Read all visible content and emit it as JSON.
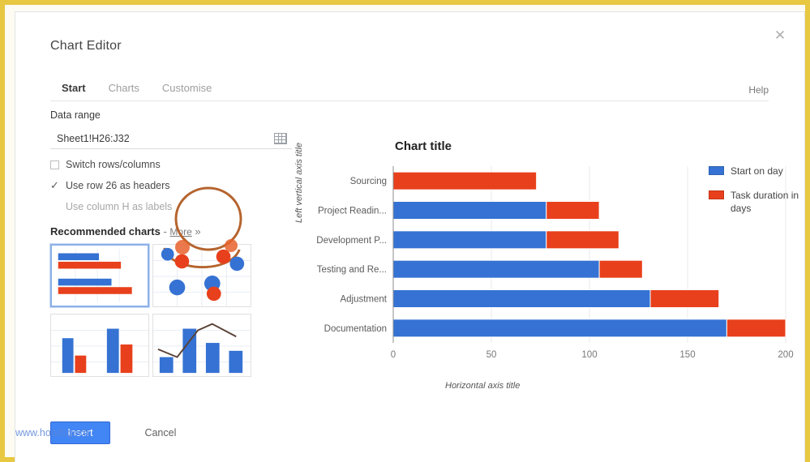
{
  "dialog": {
    "title": "Chart Editor",
    "close_icon": "close-icon",
    "help_label": "Help"
  },
  "tabs": [
    {
      "label": "Start",
      "active": true
    },
    {
      "label": "Charts",
      "active": false
    },
    {
      "label": "Customise",
      "active": false
    }
  ],
  "data_range": {
    "label": "Data range",
    "value": "Sheet1!H26:J32",
    "grid_icon": "select-range-grid-icon"
  },
  "options": [
    {
      "label": "Switch rows/columns",
      "checked": false,
      "enabled": true
    },
    {
      "label": "Use row 26 as headers",
      "checked": true,
      "enabled": true
    },
    {
      "label": "Use column H as labels",
      "checked": false,
      "enabled": false
    }
  ],
  "recommended": {
    "heading": "Recommended charts",
    "dash": "-",
    "more_label": "More",
    "more_arrow": "»",
    "thumbnails": [
      {
        "name": "bar-chart-thumbnail",
        "selected": true
      },
      {
        "name": "bubble-chart-thumbnail",
        "selected": false
      },
      {
        "name": "column-chart-thumbnail",
        "selected": false
      },
      {
        "name": "combo-chart-thumbnail",
        "selected": false
      }
    ]
  },
  "footer": {
    "insert_label": "Insert",
    "cancel_label": "Cancel",
    "watermark": "www.hoodsgech"
  },
  "chart_data": {
    "type": "bar",
    "title": "Chart title",
    "xlabel": "Horizontal axis title",
    "ylabel": "Left vertical axis title",
    "orientation": "horizontal",
    "stacked": true,
    "grid": true,
    "legend_position": "right",
    "xlim": [
      0,
      200
    ],
    "xticks": [
      0,
      50,
      100,
      150,
      200
    ],
    "categories": [
      "Sourcing",
      "Project Readin...",
      "Development P...",
      "Testing and Re...",
      "Adjustment",
      "Documentation"
    ],
    "series": [
      {
        "name": "Start on day",
        "color": "#3572d3",
        "values": [
          0,
          78,
          78,
          105,
          131,
          170
        ]
      },
      {
        "name": "Task duration in days",
        "color": "#e8401c",
        "values": [
          73,
          27,
          37,
          22,
          35,
          30
        ]
      }
    ]
  },
  "annotation": {
    "name": "hand-drawn-circle-highlight",
    "color": "#b5642e",
    "targets": "More link"
  }
}
